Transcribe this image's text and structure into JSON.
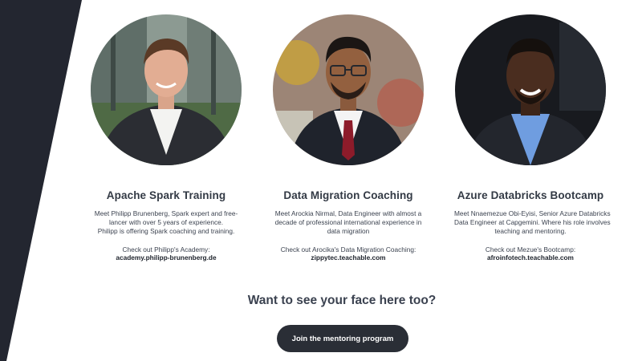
{
  "colors": {
    "stripe": "#232630",
    "button_bg": "#2a2e36",
    "button_text": "#ffffff",
    "heading": "#3b4250",
    "body_text": "#3c4350"
  },
  "cards": [
    {
      "title": "Apache Spark Training",
      "desc_lines": [
        "Meet Philipp Brunenberg, Spark expert and free-",
        "lancer with over 5 years of experience.",
        "Philipp is offering Spark coaching and training."
      ],
      "cta": "Check out Philipp's Academy:",
      "link": "academy.philipp-brunenberg.de"
    },
    {
      "title": "Data Migration Coaching",
      "desc_lines": [
        "Meet Arockia Nirmal, Data Engineer with almost a",
        "decade of professional international experience in",
        "data migration"
      ],
      "cta": "Check out Arocika's Data Migration Coaching:",
      "link": "zippytec.teachable.com"
    },
    {
      "title": "Azure Databricks Bootcamp",
      "desc_lines": [
        "Meet Nnaemezue Obi-Eyisi, Senior Azure Databricks",
        "Data Engineer at Capgemini. Where his role involves",
        "teaching and mentoring."
      ],
      "cta": "Check out Mezue's Bootcamp:",
      "link": "afroinfotech.teachable.com"
    }
  ],
  "cta_section": {
    "heading": "Want to see your face here too?",
    "button_label": "Join the mentoring program"
  }
}
